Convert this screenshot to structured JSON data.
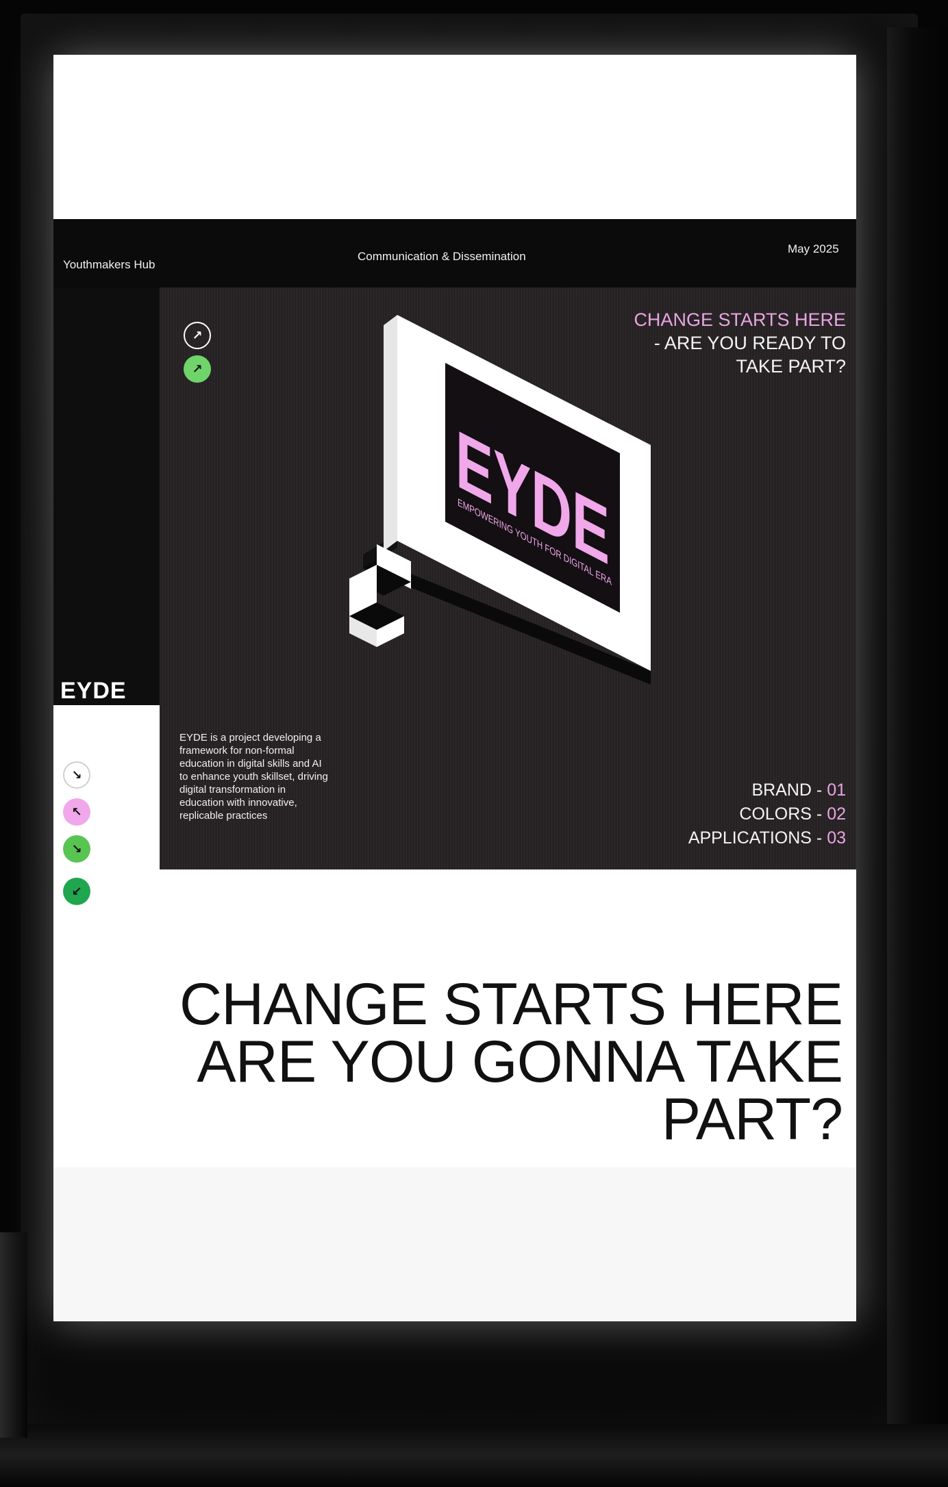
{
  "header": {
    "left": "Youthmakers Hub",
    "center": "Communication & Dissemination",
    "right": "May 2025"
  },
  "hero": {
    "headline_line1": "CHANGE STARTS HERE",
    "headline_line2": "- ARE YOU READY TO",
    "headline_line3": "TAKE PART?",
    "sign_logo": "EYDE",
    "sign_tagline": "EMPOWERING YOUTH FOR DIGITAL ERA"
  },
  "side": {
    "wordmark": "EYDE"
  },
  "description": {
    "line1": "EYDE is a project developing a",
    "line2": "framework for non-formal",
    "line3": "education in digital skills and AI",
    "line4": "to enhance youth skillset, driving",
    "line5": "digital transformation in",
    "line6": "education with innovative,",
    "line7": "replicable practices"
  },
  "index": [
    {
      "label": "BRAND - ",
      "num": "01"
    },
    {
      "label": "COLORS - ",
      "num": "02"
    },
    {
      "label": "APPLICATIONS - ",
      "num": "03"
    }
  ],
  "big_headline": {
    "line1": "CHANGE STARTS HERE",
    "line2": "ARE YOU GONNA TAKE",
    "line3": "PART?"
  },
  "icons": {
    "hero_arrow_1": "arrow-up-right-icon",
    "hero_arrow_2": "arrow-up-right-icon",
    "side_arrow_1": "arrow-down-right-icon",
    "side_arrow_2": "arrow-up-left-icon",
    "side_arrow_3": "arrow-down-right-icon",
    "side_arrow_4": "arrow-down-left-icon"
  },
  "colors": {
    "pink": "#e8a6e0",
    "green": "#6fd56a",
    "dark_green": "#1fa64f",
    "panel": "#262224",
    "black": "#0b0b0b"
  }
}
